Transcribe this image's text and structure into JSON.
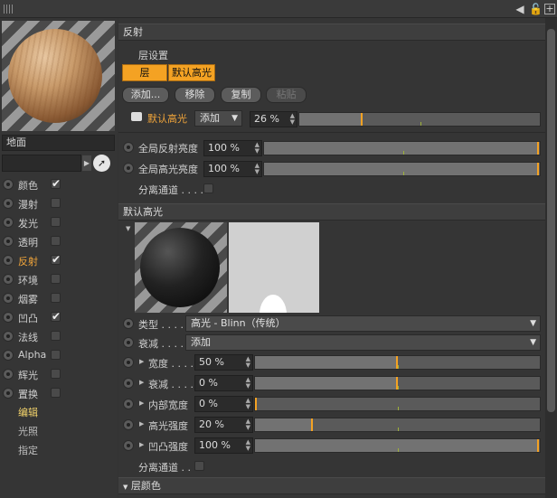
{
  "toolbar": {
    "icons": [
      "grip-icon",
      "arrow-icon",
      "lock-icon",
      "new-window-icon"
    ]
  },
  "left": {
    "material_name": "地面",
    "channels": [
      {
        "label": "颜色",
        "checked": true,
        "active": false
      },
      {
        "label": "漫射",
        "checked": false,
        "active": false
      },
      {
        "label": "发光",
        "checked": false,
        "active": false
      },
      {
        "label": "透明",
        "checked": false,
        "active": false
      },
      {
        "label": "反射",
        "checked": true,
        "active": true
      },
      {
        "label": "环境",
        "checked": false,
        "active": false
      },
      {
        "label": "烟雾",
        "checked": false,
        "active": false
      },
      {
        "label": "凹凸",
        "checked": true,
        "active": false
      },
      {
        "label": "法线",
        "checked": false,
        "active": false
      },
      {
        "label": "Alpha",
        "checked": false,
        "active": false
      },
      {
        "label": "辉光",
        "checked": false,
        "active": false
      },
      {
        "label": "置换",
        "checked": false,
        "active": false
      }
    ],
    "extra": [
      "编辑",
      "光照",
      "指定"
    ],
    "check_mark": "✔"
  },
  "reflect": {
    "section_title": "反射",
    "layer_settings": "层设置",
    "layer_btn": "层",
    "default_spec_btn": "默认高光",
    "buttons": {
      "add": "添加...",
      "remove": "移除",
      "copy": "复制",
      "paste": "粘贴"
    },
    "layer_row": {
      "name": "默认高光",
      "mode": "添加",
      "value": "26 %",
      "fraction": 0.26
    },
    "global_reflect": {
      "label": "全局反射亮度",
      "value": "100 %",
      "fraction": 1.0
    },
    "global_spec": {
      "label": "全局高光亮度",
      "value": "100 %",
      "fraction": 1.0
    },
    "separate_pass": "分离通道 . . . ."
  },
  "default_spec": {
    "section_title": "默认高光",
    "type_label": "类型 . . . . .",
    "type_value": "高光 - Blinn（传统）",
    "atten_label": "衰减 . . . . .",
    "atten_value": "添加",
    "params": [
      {
        "label": "宽度 . . . . .",
        "value": "50 %",
        "fraction": 0.5
      },
      {
        "label": "衰减 . . . . .",
        "value": "0 %",
        "fraction": 0.5
      },
      {
        "label": "内部宽度",
        "value": "0 %",
        "fraction": 0.0
      },
      {
        "label": "高光强度",
        "value": "20 %",
        "fraction": 0.2
      },
      {
        "label": "凹凸强度",
        "value": "100 %",
        "fraction": 1.0
      }
    ],
    "separate_pass": "分离通道 . .",
    "layer_color": "层颜色"
  }
}
